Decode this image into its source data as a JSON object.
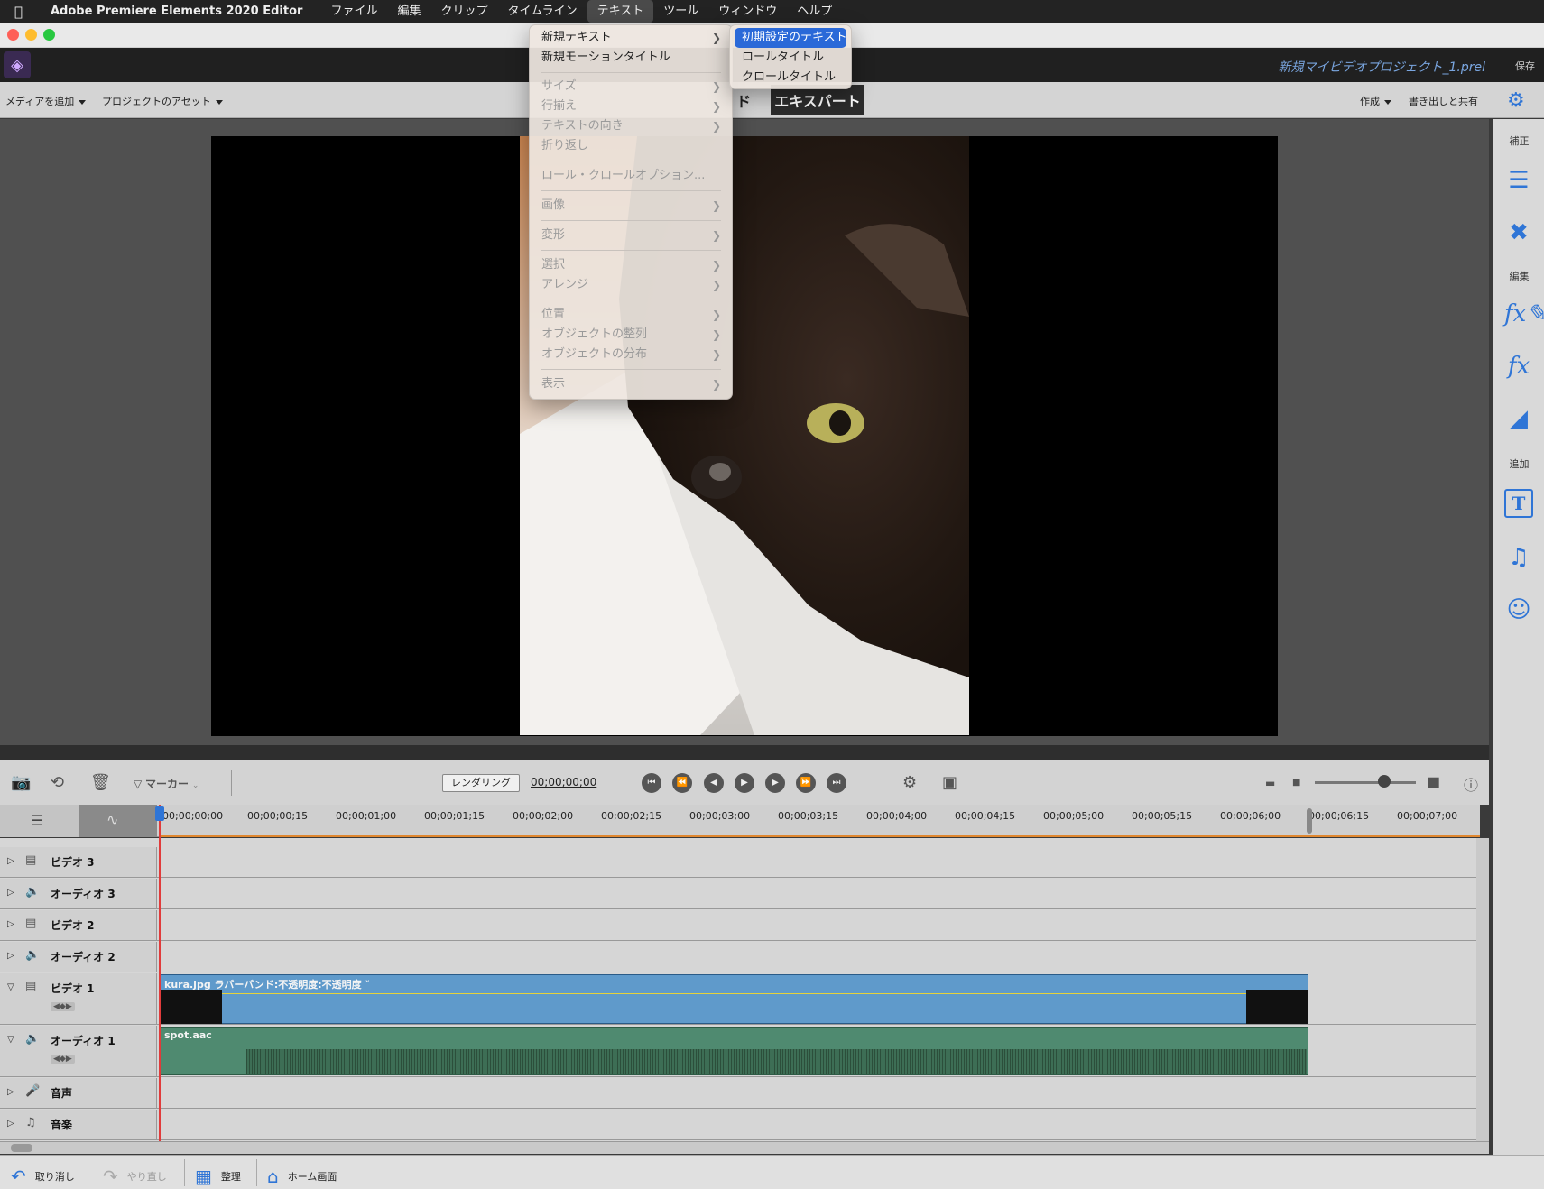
{
  "menubar": {
    "app_name": "Adobe Premiere Elements 2020 Editor",
    "items": [
      "ファイル",
      "編集",
      "クリップ",
      "タイムライン",
      "テキスト",
      "ツール",
      "ウィンドウ",
      "ヘルプ"
    ],
    "active_item": "テキスト"
  },
  "header": {
    "project_name": "新規マイビデオプロジェクト_1.prel",
    "save_label": "保存"
  },
  "modebar": {
    "add_media": "メディアを追加",
    "project_assets": "プロジェクトのアセット",
    "guided_fragment": "ド",
    "expert": "エキスパート",
    "create": "作成",
    "export_share": "書き出しと共有"
  },
  "right_panel": {
    "adjust_label": "補正",
    "edit_label": "編集",
    "add_label": "追加",
    "icons": [
      "sliders-icon",
      "tools-icon",
      "fx-edit-icon",
      "fx-icon",
      "transition-icon",
      "title-icon",
      "music-icon",
      "emoji-icon"
    ]
  },
  "timeline_toolbar": {
    "marker_label": "マーカー",
    "render_label": "レンダリング",
    "timecode": "00;00;00;00"
  },
  "ruler": {
    "ticks": [
      "00;00;00;00",
      "00;00;00;15",
      "00;00;01;00",
      "00;00;01;15",
      "00;00;02;00",
      "00;00;02;15",
      "00;00;03;00",
      "00;00;03;15",
      "00;00;04;00",
      "00;00;04;15",
      "00;00;05;00",
      "00;00;05;15",
      "00;00;06;00",
      "00;00;06;15",
      "00;00;07;00"
    ]
  },
  "tracks": {
    "video3": "ビデオ 3",
    "audio3": "オーディオ 3",
    "video2": "ビデオ 2",
    "audio2": "オーディオ 2",
    "video1": "ビデオ 1",
    "audio1": "オーディオ 1",
    "narration": "音声",
    "music": "音楽",
    "video_clip_label": "kura.jpg ラバーバンド:不透明度:不透明度 ˅",
    "audio_clip_label": "spot.aac"
  },
  "bottombar": {
    "undo": "取り消し",
    "redo": "やり直し",
    "organize": "整理",
    "home": "ホーム画面"
  },
  "text_menu": {
    "items": [
      {
        "label": "新規テキスト",
        "enabled": true,
        "submenu": true
      },
      {
        "label": "新規モーションタイトル",
        "enabled": true,
        "submenu": false
      },
      {
        "label": "サイズ",
        "enabled": false,
        "submenu": true
      },
      {
        "label": "行揃え",
        "enabled": false,
        "submenu": true
      },
      {
        "label": "テキストの向き",
        "enabled": false,
        "submenu": true
      },
      {
        "label": "折り返し",
        "enabled": false,
        "submenu": false
      },
      {
        "label": "ロール・クロールオプション...",
        "enabled": false,
        "submenu": false
      },
      {
        "label": "画像",
        "enabled": false,
        "submenu": true
      },
      {
        "label": "変形",
        "enabled": false,
        "submenu": true
      },
      {
        "label": "選択",
        "enabled": false,
        "submenu": true
      },
      {
        "label": "アレンジ",
        "enabled": false,
        "submenu": true
      },
      {
        "label": "位置",
        "enabled": false,
        "submenu": true
      },
      {
        "label": "オブジェクトの整列",
        "enabled": false,
        "submenu": true
      },
      {
        "label": "オブジェクトの分布",
        "enabled": false,
        "submenu": true
      },
      {
        "label": "表示",
        "enabled": false,
        "submenu": true
      }
    ]
  },
  "new_text_submenu": {
    "items": [
      "初期設定のテキスト",
      "ロールタイトル",
      "クロールタイトル"
    ],
    "highlighted": "初期設定のテキスト"
  },
  "colors": {
    "accent": "#2f75d6",
    "menu_highlight": "#2a69d8",
    "video_clip": "#5f9acb",
    "audio_clip": "#4f8a70",
    "playhead": "#e13b3b"
  }
}
